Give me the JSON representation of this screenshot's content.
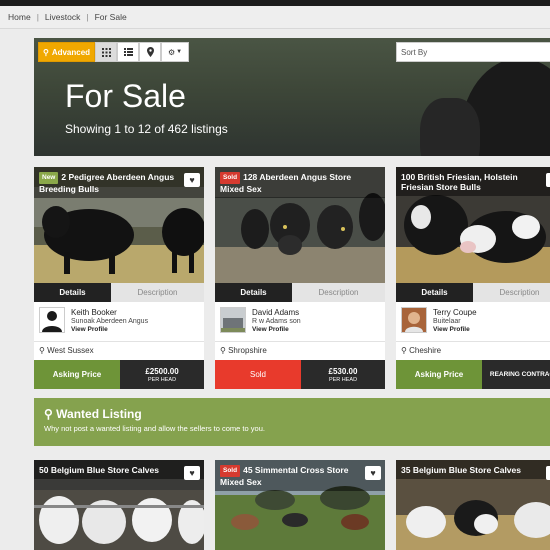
{
  "breadcrumb": [
    "Home",
    "Livestock",
    "For Sale"
  ],
  "toolbar": {
    "advanced_label": "Advanced",
    "sort_placeholder": "Sort By"
  },
  "hero": {
    "title": "For Sale",
    "subtitle": "Showing 1 to 12 of 462 listings"
  },
  "listings": [
    {
      "badge": "New",
      "title": "2 Pedigree Aberdeen Angus Breeding Bulls",
      "tab_details": "Details",
      "tab_description": "Description",
      "seller_name": "Keith Booker",
      "seller_farm": "Sunoak Aberdeen Angus",
      "view_profile": "View Profile",
      "location": "West Sussex",
      "price_label": "Asking Price",
      "price": "£2500.00",
      "price_unit": "PER HEAD"
    },
    {
      "badge": "Sold",
      "title": "128 Aberdeen Angus Store Mixed Sex",
      "tab_details": "Details",
      "tab_description": "Description",
      "seller_name": "David Adams",
      "seller_farm": "R w Adams son",
      "view_profile": "View Profile",
      "location": "Shropshire",
      "price_label": "Sold",
      "price": "£530.00",
      "price_unit": "PER HEAD"
    },
    {
      "badge": "",
      "title": "100 British Friesian, Holstein Friesian Store Bulls",
      "tab_details": "Details",
      "tab_description": "Description",
      "seller_name": "Terry Coupe",
      "seller_farm": "Buitelaar",
      "view_profile": "View Profile",
      "location": "Cheshire",
      "price_label": "Asking Price",
      "price_text": "REARING CONTRACT"
    }
  ],
  "wanted": {
    "title": "Wanted Listing",
    "subtitle": "Why not post a wanted listing and allow the sellers to come to you."
  },
  "listings_row2": [
    {
      "badge": "",
      "title": "50 Belgium Blue Store Calves"
    },
    {
      "badge": "Sold",
      "title": "45 Simmental Cross Store Mixed Sex"
    },
    {
      "badge": "",
      "title": "35 Belgium Blue Store Calves"
    }
  ],
  "colors": {
    "accent_orange": "#f0a800",
    "price_green": "#6e9438",
    "sold_red": "#e83a2c",
    "wanted_green": "#85a24e"
  }
}
